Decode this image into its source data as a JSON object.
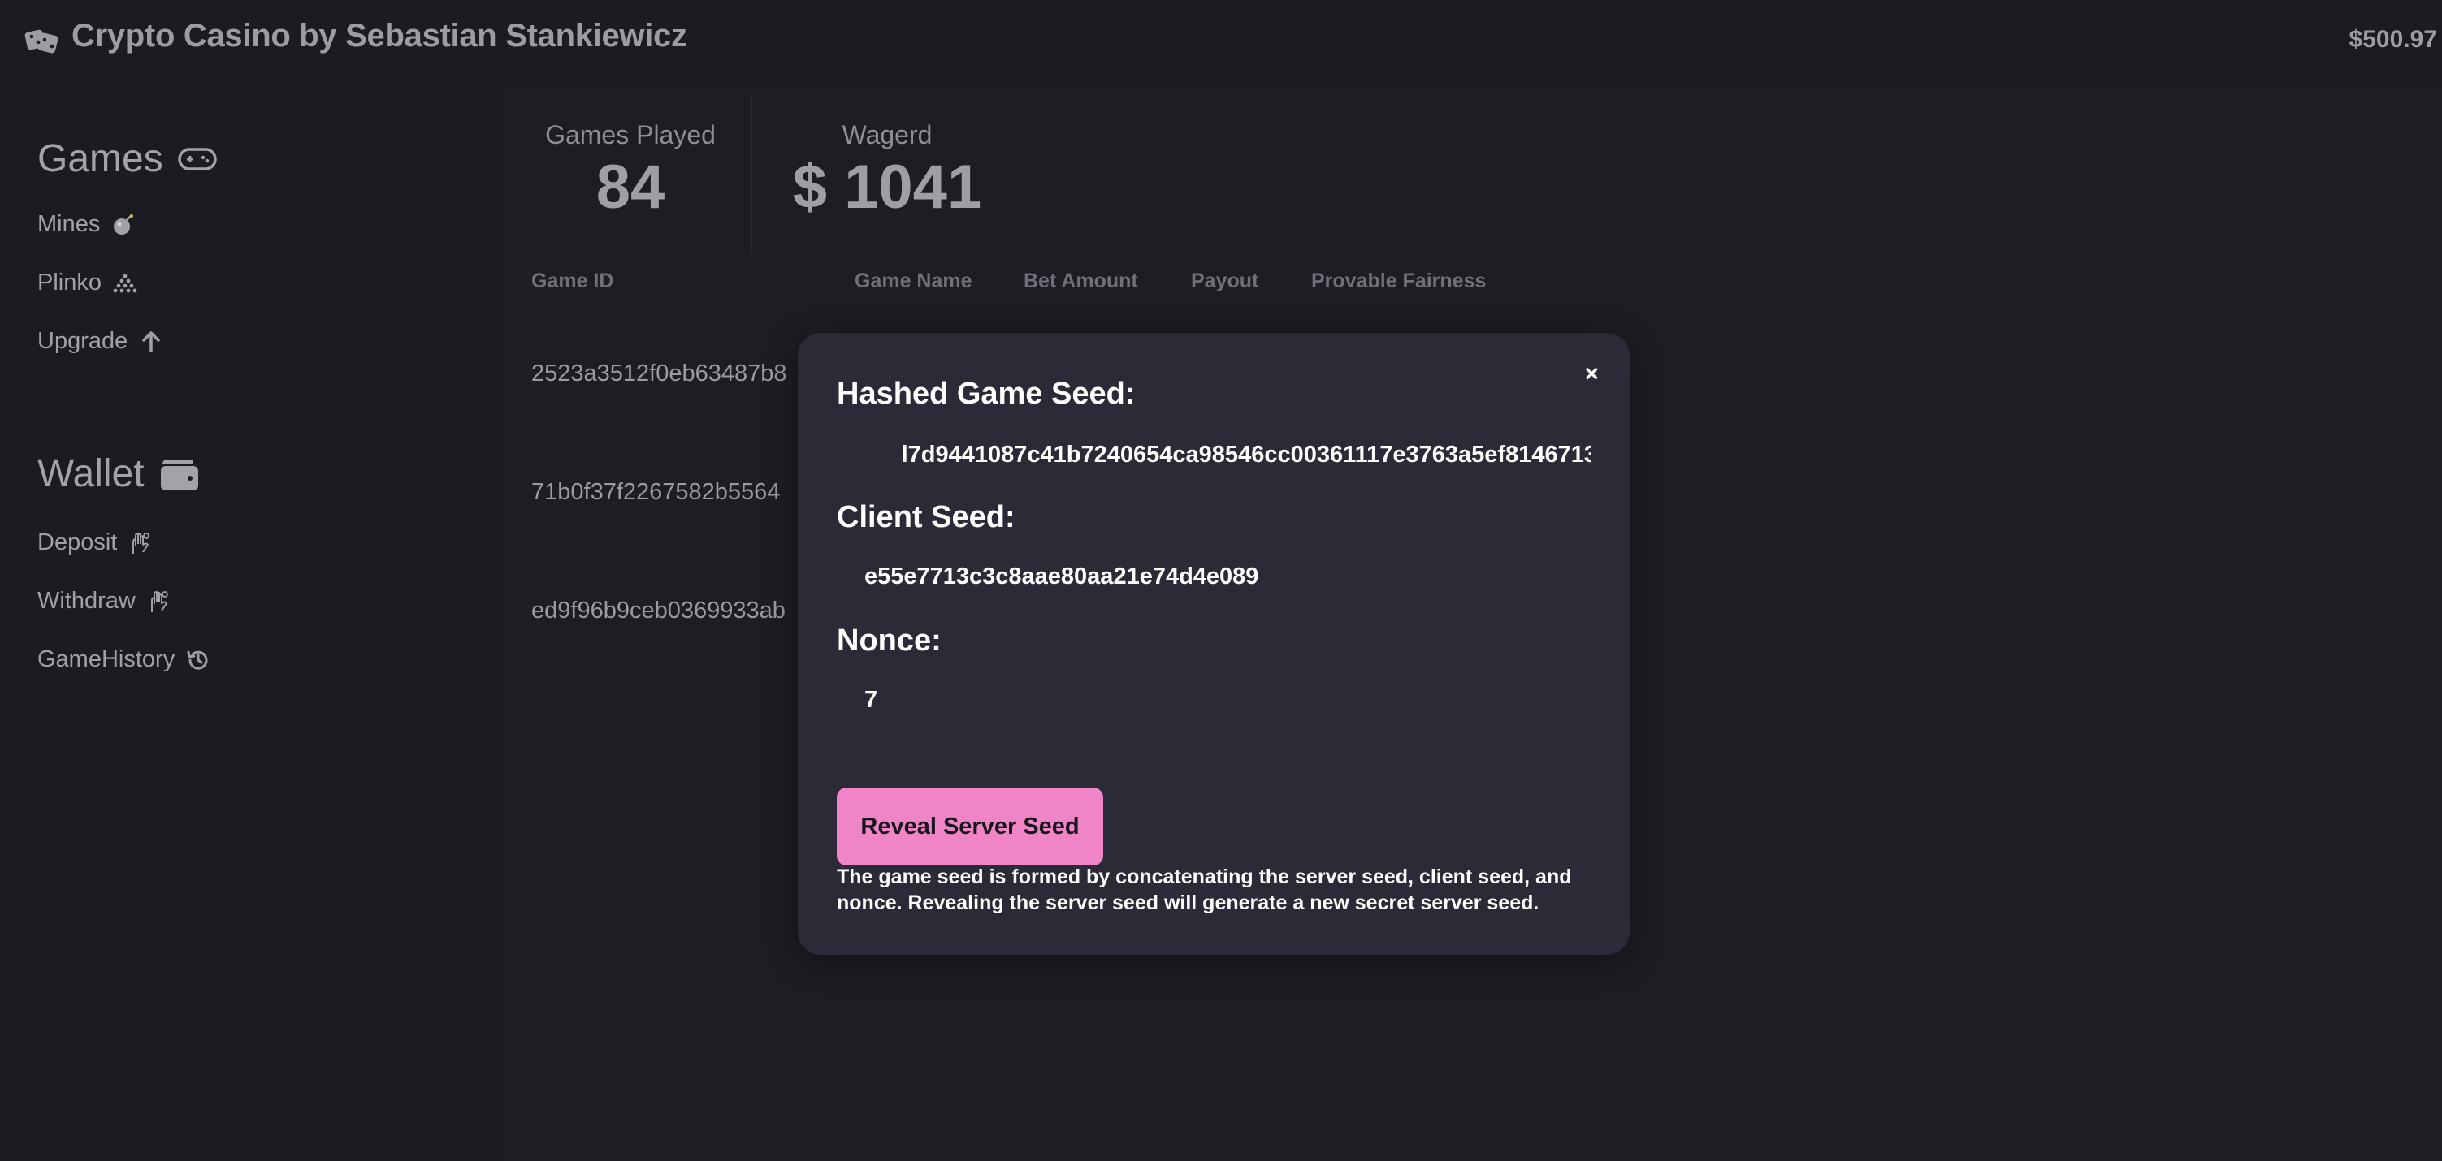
{
  "header": {
    "title": "Crypto Casino by Sebastian Stankiewicz",
    "balance": "$500.97",
    "logo_icon": "dice-icon"
  },
  "sidebar": {
    "games_title": "Games",
    "games_icon": "gamepad-icon",
    "games": [
      {
        "label": "Mines",
        "icon": "bomb-icon"
      },
      {
        "label": "Plinko",
        "icon": "pyramid-icon"
      },
      {
        "label": "Upgrade",
        "icon": "arrow-up-icon"
      }
    ],
    "wallet_title": "Wallet",
    "wallet_icon": "wallet-icon",
    "wallet": [
      {
        "label": "Deposit",
        "icon": "hand-coin-icon"
      },
      {
        "label": "Withdraw",
        "icon": "hand-coin-icon"
      },
      {
        "label": "GameHistory",
        "icon": "history-icon"
      }
    ]
  },
  "stats": {
    "games_played_label": "Games Played",
    "games_played_value": "84",
    "wagered_label": "Wagerd",
    "wagered_value": "$ 1041"
  },
  "table": {
    "columns": [
      "Game ID",
      "Game Name",
      "Bet Amount",
      "Payout",
      "Provable Fairness"
    ],
    "rows": [
      {
        "game_id": "2523a3512f0eb63487b8"
      },
      {
        "game_id": "71b0f37f2267582b5564"
      },
      {
        "game_id": "ed9f96b9ceb0369933ab"
      }
    ]
  },
  "modal": {
    "close_label": "×",
    "hashed_seed_label": "Hashed Game Seed:",
    "hashed_seed_value": "l7d9441087c41b7240654ca98546cc00361117e3763a5ef8146713",
    "client_seed_label": "Client Seed:",
    "client_seed_value": "e55e7713c3c8aae80aa21e74d4e089",
    "nonce_label": "Nonce:",
    "nonce_value": "7",
    "reveal_button": "Reveal Server Seed",
    "note": "The game seed is formed by concatenating the server seed, client seed, and nonce. Revealing the server seed will generate a new secret server seed."
  },
  "colors": {
    "background": "#1b1c22",
    "modal_background": "#2a2b37",
    "accent": "#ef85c7"
  }
}
